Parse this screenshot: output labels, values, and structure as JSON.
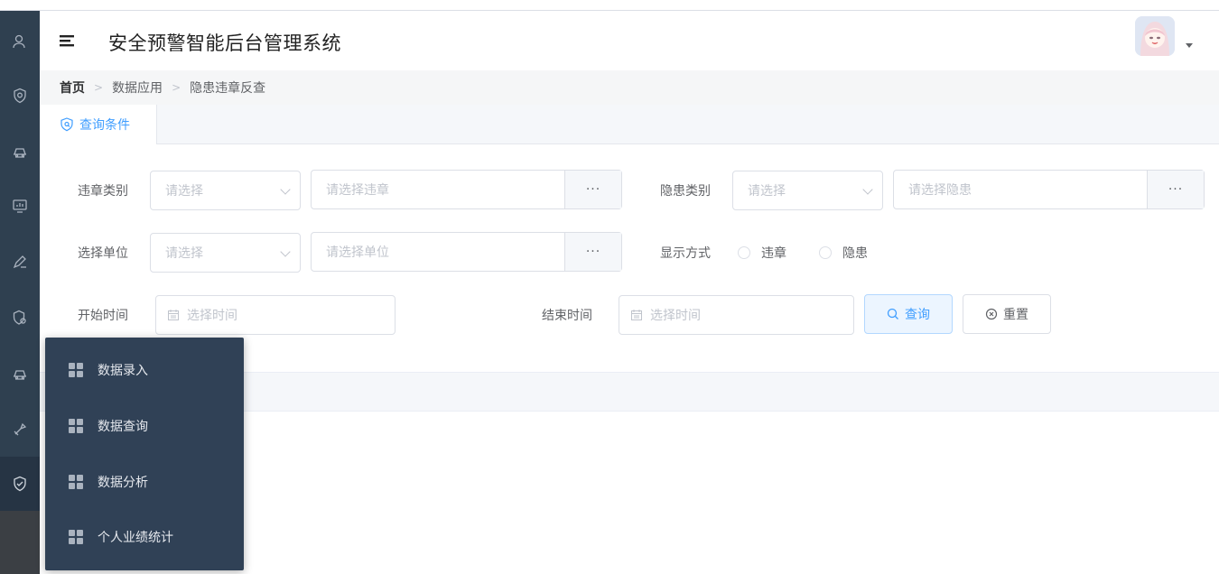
{
  "header": {
    "title": "安全预警智能后台管理系统"
  },
  "breadcrumb": {
    "home": "首页",
    "level1": "数据应用",
    "level2": "隐患违章反查"
  },
  "tabs": {
    "query_conditions": "查询条件"
  },
  "form": {
    "violation_category": {
      "label": "违章类别",
      "placeholder": "请选择"
    },
    "violation_picker": {
      "placeholder": "请选择违章",
      "button": "···"
    },
    "hazard_category": {
      "label": "隐患类别",
      "placeholder": "请选择"
    },
    "hazard_picker": {
      "placeholder": "请选择隐患",
      "button": "···"
    },
    "unit_select": {
      "label": "选择单位",
      "placeholder": "请选择"
    },
    "unit_picker": {
      "placeholder": "请选择单位",
      "button": "···"
    },
    "display_mode": {
      "label": "显示方式",
      "options": [
        "违章",
        "隐患"
      ]
    },
    "start_time": {
      "label": "开始时间",
      "placeholder": "选择时间"
    },
    "end_time": {
      "label": "结束时间",
      "placeholder": "选择时间"
    },
    "query_button": "查询",
    "reset_button": "重置"
  },
  "flyout_menu": {
    "items": [
      "数据录入",
      "数据查询",
      "数据分析",
      "个人业绩统计"
    ]
  },
  "sidebar_icons": [
    "user-icon",
    "shield-icon",
    "vehicle-icon",
    "monitor-chart-icon",
    "pen-icon",
    "shield-gear-icon",
    "vehicle-icon",
    "tools-icon",
    "shield-check-icon"
  ],
  "colors": {
    "sidebar": "#2f4050",
    "flyout": "#304156",
    "accent": "#409eff"
  }
}
